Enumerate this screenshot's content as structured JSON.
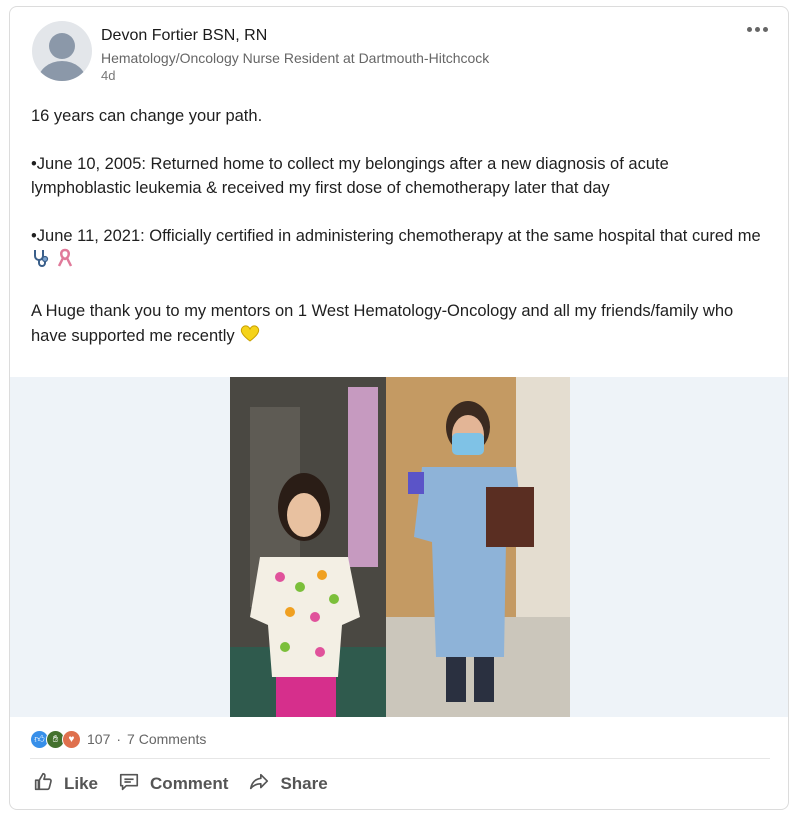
{
  "post": {
    "author_name": "Devon Fortier BSN, RN",
    "headline": "Hematology/Oncology Nurse Resident at Dartmouth-Hitchcock",
    "timestamp": "4d",
    "paragraphs": [
      "16 years can change your path.",
      "•June 10, 2005: Returned home to collect my belongings after a new diagnosis of acute lymphoblastic leukemia & received my first dose of chemotherapy later that day",
      "•June 11, 2021: Officially certified in administering chemotherapy at the same hospital that cured me",
      "A Huge thank you to my mentors on 1 West Hematology-Oncology and all my friends/family who have supported me recently"
    ]
  },
  "engagement": {
    "reaction_count": "107",
    "separator": "·",
    "comments": "7 Comments"
  },
  "actions": {
    "like": "Like",
    "comment": "Comment",
    "share": "Share"
  },
  "colors": {
    "like_blue": "#378fe9",
    "support_green": "#44712e",
    "love_red": "#df704d",
    "media_bg": "#eef3f8"
  },
  "icons": [
    "more-icon",
    "stethoscope-icon",
    "ribbon-icon",
    "yellow-heart-icon",
    "like-icon",
    "comment-icon",
    "share-icon"
  ]
}
